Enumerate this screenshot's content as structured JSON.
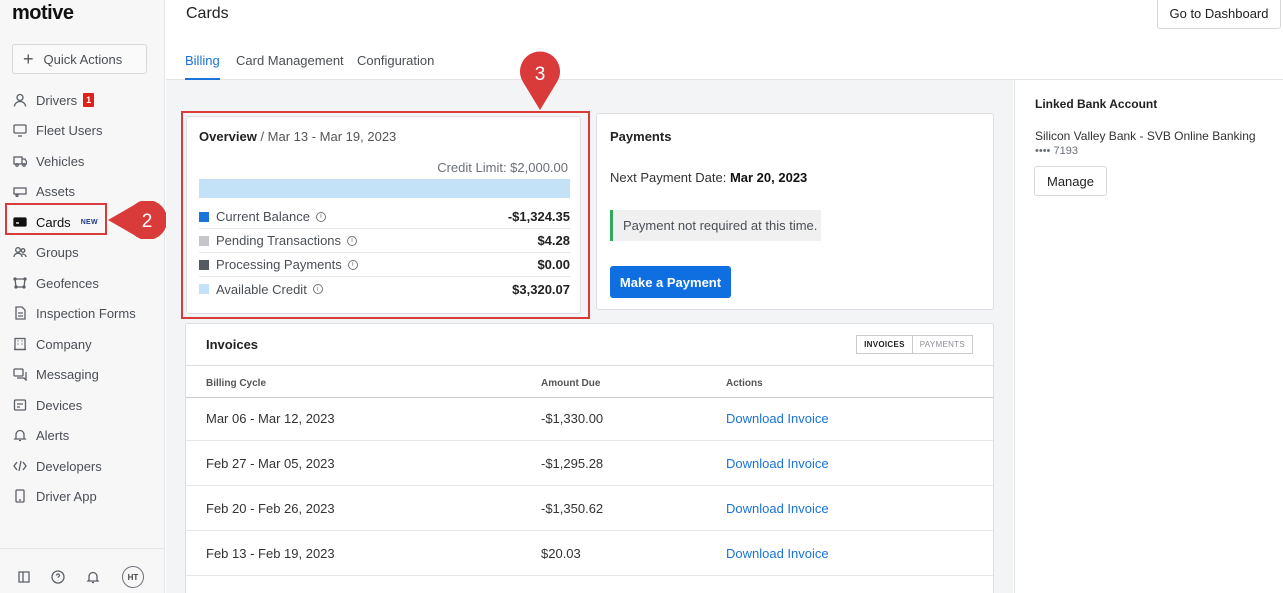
{
  "brand": {
    "logo_text": "motive"
  },
  "sidebar": {
    "quick_actions": "Quick Actions",
    "items": [
      {
        "label": "Drivers",
        "icon": "user-icon",
        "badge": "1"
      },
      {
        "label": "Fleet Users",
        "icon": "monitor-icon"
      },
      {
        "label": "Vehicles",
        "icon": "truck-icon"
      },
      {
        "label": "Assets",
        "icon": "trailer-icon"
      },
      {
        "label": "Cards",
        "icon": "card-icon",
        "tag": "NEW"
      },
      {
        "label": "Groups",
        "icon": "group-icon"
      },
      {
        "label": "Geofences",
        "icon": "geofence-icon"
      },
      {
        "label": "Inspection Forms",
        "icon": "document-icon"
      },
      {
        "label": "Company",
        "icon": "building-icon"
      },
      {
        "label": "Messaging",
        "icon": "chat-icon"
      },
      {
        "label": "Devices",
        "icon": "device-icon"
      },
      {
        "label": "Alerts",
        "icon": "bell-icon"
      },
      {
        "label": "Developers",
        "icon": "code-icon"
      },
      {
        "label": "Driver App",
        "icon": "phone-icon"
      }
    ],
    "avatar_initials": "HT"
  },
  "header": {
    "title": "Cards",
    "dashboard_button": "Go to Dashboard",
    "tabs": [
      "Billing",
      "Card Management",
      "Configuration"
    ]
  },
  "overview": {
    "title": "Overview",
    "date_range": "Mar 13 - Mar 19, 2023",
    "credit_limit": "Credit Limit: $2,000.00",
    "rows": [
      {
        "label": "Current Balance",
        "value": "-$1,324.35",
        "color": "#1a73d9"
      },
      {
        "label": "Pending Transactions",
        "value": "$4.28",
        "color": "#c4c6c9"
      },
      {
        "label": "Processing Payments",
        "value": "$0.00",
        "color": "#555a60"
      },
      {
        "label": "Available Credit",
        "value": "$3,320.07",
        "color": "#c3e2f8"
      }
    ]
  },
  "payments": {
    "title": "Payments",
    "next_label": "Next Payment Date:",
    "next_date": "Mar 20, 2023",
    "note": "Payment not required at this time.",
    "button": "Make a Payment"
  },
  "invoices": {
    "title": "Invoices",
    "toggle": [
      "INVOICES",
      "PAYMENTS"
    ],
    "columns": [
      "Billing Cycle",
      "Amount Due",
      "Actions"
    ],
    "rows": [
      {
        "cycle": "Mar 06 - Mar 12, 2023",
        "amount": "-$1,330.00",
        "action": "Download Invoice"
      },
      {
        "cycle": "Feb 27 - Mar 05, 2023",
        "amount": "-$1,295.28",
        "action": "Download Invoice"
      },
      {
        "cycle": "Feb 20 - Feb 26, 2023",
        "amount": "-$1,350.62",
        "action": "Download Invoice"
      },
      {
        "cycle": "Feb 13 - Feb 19, 2023",
        "amount": "$20.03",
        "action": "Download Invoice"
      }
    ]
  },
  "linked_bank": {
    "title": "Linked Bank Account",
    "bank": "Silicon Valley Bank - SVB Online Banking",
    "account": "•••• 7193",
    "button": "Manage"
  },
  "callouts": {
    "step_2": "2",
    "step_3": "3",
    "highlight_color": "#d93b3b"
  }
}
